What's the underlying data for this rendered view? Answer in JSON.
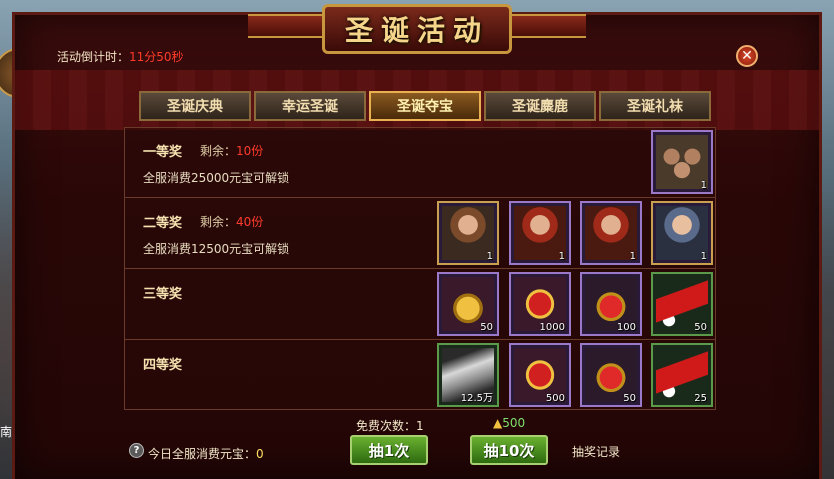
{
  "title": "圣诞活动",
  "countdown": {
    "label": "活动倒计时：",
    "value": "11分50秒"
  },
  "tabs": [
    {
      "label": "圣诞庆典",
      "active": false
    },
    {
      "label": "幸运圣诞",
      "active": false
    },
    {
      "label": "圣诞夺宝",
      "active": true
    },
    {
      "label": "圣诞麋鹿",
      "active": false
    },
    {
      "label": "圣诞礼袜",
      "active": false
    }
  ],
  "prizes": [
    {
      "title": "一等奖",
      "remain_label": "剩余：",
      "remain_value": "10份",
      "unlock": "全服消费25000元宝可解锁",
      "items": [
        {
          "icon": "hero-group-icon",
          "count": "1"
        }
      ]
    },
    {
      "title": "二等奖",
      "remain_label": "剩余：",
      "remain_value": "40份",
      "unlock": "全服消费12500元宝可解锁",
      "items": [
        {
          "icon": "hero-portrait-icon",
          "count": "1"
        },
        {
          "icon": "hero-portrait-icon",
          "count": "1"
        },
        {
          "icon": "hero-portrait-icon",
          "count": "1"
        },
        {
          "icon": "hero-portrait-icon",
          "count": "1"
        }
      ]
    },
    {
      "title": "三等奖",
      "items": [
        {
          "icon": "medal-icon",
          "count": "50"
        },
        {
          "icon": "red-token-icon",
          "count": "1000"
        },
        {
          "icon": "red-orb-icon",
          "count": "100"
        },
        {
          "icon": "santa-hat-icon",
          "count": "50"
        }
      ]
    },
    {
      "title": "四等奖",
      "items": [
        {
          "icon": "silver-ingot-icon",
          "count": "12.5万"
        },
        {
          "icon": "red-token-icon",
          "count": "500"
        },
        {
          "icon": "red-orb-icon",
          "count": "50"
        },
        {
          "icon": "santa-hat-icon",
          "count": "25"
        }
      ]
    }
  ],
  "footer": {
    "free_label": "免费次数：",
    "free_value": "1",
    "gold_cost": "500",
    "draw1": "抽1次",
    "draw10": "抽10次",
    "record": "抽奖记录",
    "spend_label": "今日全服消费元宝：",
    "spend_value": "0"
  },
  "side": {
    "label": "南"
  },
  "colors": {
    "accent": "#ff3b2b",
    "button": "#4e9a20",
    "tab_active": "#8a5a20"
  }
}
